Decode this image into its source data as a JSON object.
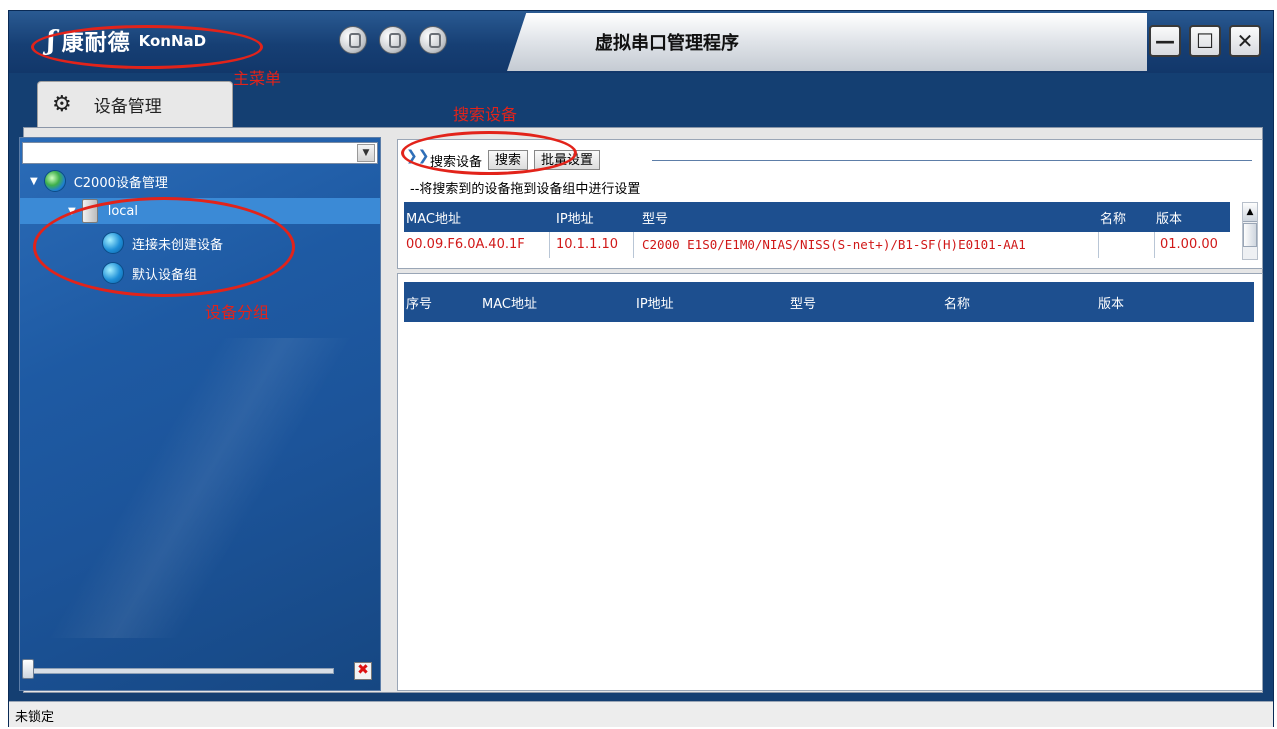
{
  "window": {
    "logo_text_cn": "康耐德",
    "logo_text_en": "KonNaD",
    "title": "虚拟串口管理程序",
    "min_glyph": "—",
    "max_glyph": "☐",
    "close_glyph": "✕"
  },
  "annotations": {
    "main_menu": "主菜单",
    "search_device": "搜索设备",
    "device_group": "设备分组"
  },
  "tabs": [
    {
      "label": "设备管理",
      "icon": "gear-icon"
    }
  ],
  "tree": {
    "root": "C2000设备管理",
    "node": "local",
    "children": [
      "连接未创建设备",
      "默认设备组"
    ]
  },
  "search": {
    "label": "搜索设备",
    "search_button": "搜索",
    "batch_button": "批量设置",
    "hint": "--将搜索到的设备拖到设备组中进行设置",
    "columns": [
      "MAC地址",
      "IP地址",
      "型号",
      "名称",
      "版本"
    ],
    "rows": [
      {
        "mac": "00.09.F6.0A.40.1F",
        "ip": "10.1.1.10",
        "model": "C2000 E1S0/E1M0/NIAS/NISS(S-net+)/B1-SF(H)E0101-AA1",
        "name": "",
        "version": "01.00.00"
      }
    ]
  },
  "device_list": {
    "columns": [
      "序号",
      "MAC地址",
      "IP地址",
      "型号",
      "名称",
      "版本"
    ]
  },
  "status": {
    "text": "未锁定"
  },
  "colors": {
    "frame_blue": "#143f72",
    "grid_header": "#1d4f8f",
    "row_text_red": "#d01818",
    "annotation_red": "#e2231a"
  }
}
